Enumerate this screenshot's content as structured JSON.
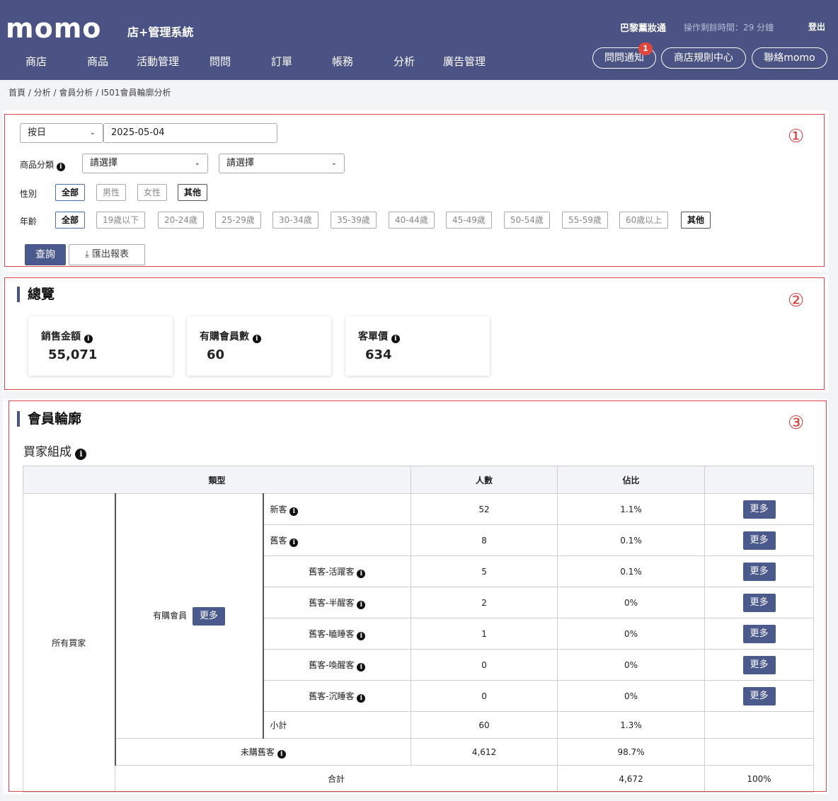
{
  "header": {
    "logo": "momo",
    "subtitle": "店+管理系統",
    "user": "巴黎薰妝通",
    "timer": "操作剩餘時間：29 分鐘",
    "logout": "登出",
    "nav": [
      "商店",
      "商品",
      "活動管理",
      "問問",
      "訂單",
      "帳務",
      "分析",
      "廣告管理"
    ],
    "pills": [
      "問問通知",
      "商店規則中心",
      "聯絡momo"
    ],
    "notif_count": "1"
  },
  "breadcrumb": "首頁 / 分析 / 會員分析 / I501會員輪廓分析",
  "filters": {
    "period_select": "按日",
    "date": "2025-05-04",
    "category_label": "商品分類",
    "category_select_1": "請選擇",
    "category_select_2": "請選擇",
    "gender_label": "性別",
    "gender_options": [
      "全部",
      "男性",
      "女性",
      "其他"
    ],
    "age_label": "年齡",
    "age_options": [
      "全部",
      "19歲以下",
      "20-24歲",
      "25-29歲",
      "30-34歲",
      "35-39歲",
      "40-44歲",
      "45-49歲",
      "50-54歲",
      "55-59歲",
      "60歲以上",
      "其他"
    ],
    "query_button": "查詢",
    "export_button": "匯出報表"
  },
  "markers": [
    "①",
    "②",
    "③"
  ],
  "overview": {
    "title": "總覽",
    "cards": [
      {
        "label": "銷售金額",
        "value": "55,071"
      },
      {
        "label": "有購會員數",
        "value": "60"
      },
      {
        "label": "客單價",
        "value": "634"
      }
    ]
  },
  "profile": {
    "title": "會員輪廓",
    "subtitle": "買家組成",
    "headers": {
      "type": "類型",
      "count": "人數",
      "ratio": "佔比"
    },
    "all_buyers": "所有買家",
    "purchasing_members": "有購會員",
    "more_label": "更多",
    "rows": [
      {
        "label": "新客",
        "count": "52",
        "ratio": "1.1%"
      },
      {
        "label": "舊客",
        "count": "8",
        "ratio": "0.1%"
      },
      {
        "label": "舊客-活躍客",
        "count": "5",
        "ratio": "0.1%"
      },
      {
        "label": "舊客-半醒客",
        "count": "2",
        "ratio": "0%"
      },
      {
        "label": "舊客-瞌睡客",
        "count": "1",
        "ratio": "0%"
      },
      {
        "label": "舊客-喚醒客",
        "count": "0",
        "ratio": "0%"
      },
      {
        "label": "舊客-沉睡客",
        "count": "0",
        "ratio": "0%"
      }
    ],
    "subtotal": {
      "label": "小計",
      "count": "60",
      "ratio": "1.3%"
    },
    "non_purchasing": {
      "label": "未購舊客",
      "count": "4,612",
      "ratio": "98.7%"
    },
    "total": {
      "label": "合計",
      "count": "4,672",
      "ratio": "100%"
    }
  }
}
